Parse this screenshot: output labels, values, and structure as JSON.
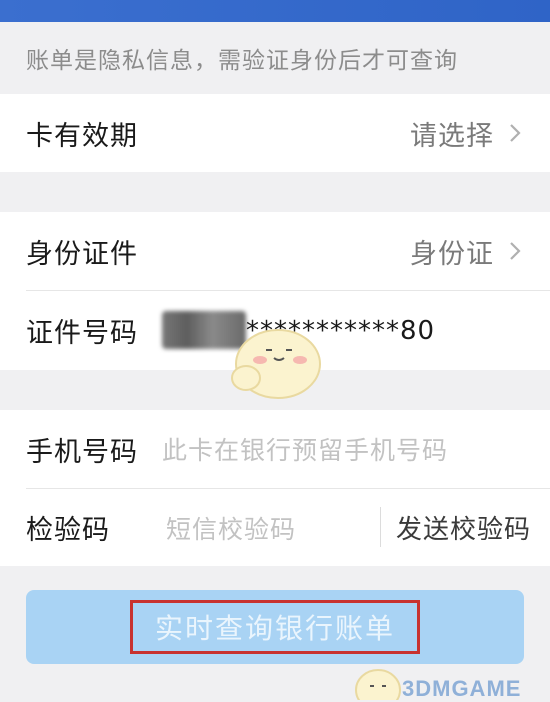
{
  "notice": {
    "text": "账单是隐私信息，需验证身份后才可查询"
  },
  "card_expiry": {
    "label": "卡有效期",
    "value": "请选择"
  },
  "id_type": {
    "label": "身份证件",
    "value": "身份证"
  },
  "id_number": {
    "label": "证件号码",
    "value": "***********80"
  },
  "phone": {
    "label": "手机号码",
    "placeholder": "此卡在银行预留手机号码"
  },
  "verify_code": {
    "label": "检验码",
    "placeholder": "短信校验码",
    "send_label": "发送校验码"
  },
  "query_button": {
    "label": "实时查询银行账单"
  },
  "watermark": {
    "text": "3DMGAME"
  },
  "colors": {
    "header": "#2f64c7",
    "button": "#a9d3f4",
    "highlight_box": "#c8322f",
    "page_bg": "#f0f0f2"
  }
}
